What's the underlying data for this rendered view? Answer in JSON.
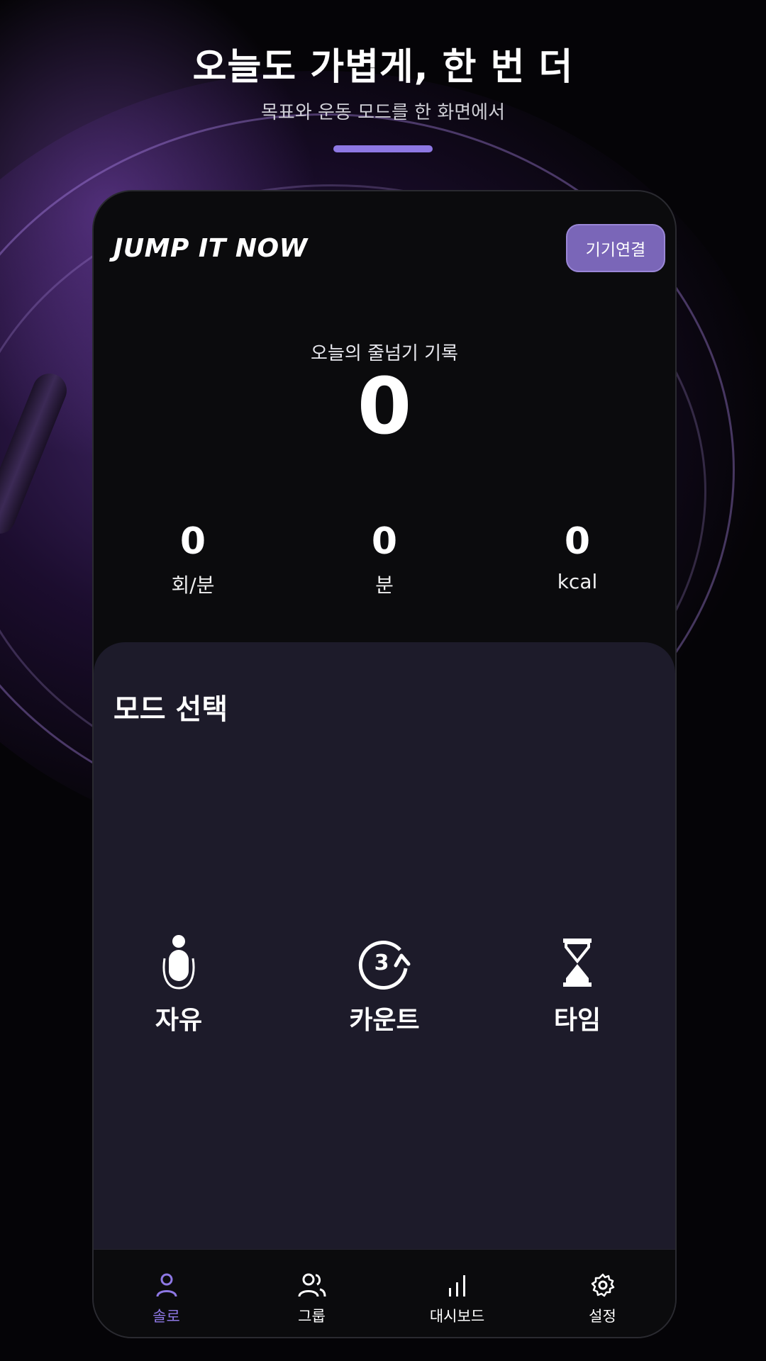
{
  "hero": {
    "title": "오늘도 가볍게, 한 번 더",
    "subtitle": "목표와 운동 모드를 한 화면에서"
  },
  "app": {
    "brand": "JUMP IT NOW",
    "connect_button": "기기연결",
    "today": {
      "label": "오늘의 줄넘기 기록",
      "value": "0"
    },
    "stats": [
      {
        "value": "0",
        "unit": "회/분"
      },
      {
        "value": "0",
        "unit": "분"
      },
      {
        "value": "0",
        "unit": "kcal"
      }
    ],
    "mode_section": {
      "title": "모드 선택",
      "modes": [
        {
          "label": "자유",
          "icon": "jump-rope-person-icon"
        },
        {
          "label": "카운트",
          "icon": "countdown-3-icon"
        },
        {
          "label": "타임",
          "icon": "hourglass-icon"
        }
      ]
    },
    "tabs": [
      {
        "label": "솔로",
        "icon": "person-icon",
        "active": true
      },
      {
        "label": "그룹",
        "icon": "group-icon",
        "active": false
      },
      {
        "label": "대시보드",
        "icon": "bar-chart-icon",
        "active": false
      },
      {
        "label": "설정",
        "icon": "gear-icon",
        "active": false
      }
    ]
  },
  "colors": {
    "accent": "#8e78e4",
    "button": "#7a66b8",
    "panel": "#1d1b2a",
    "background": "#0b0b0d"
  }
}
